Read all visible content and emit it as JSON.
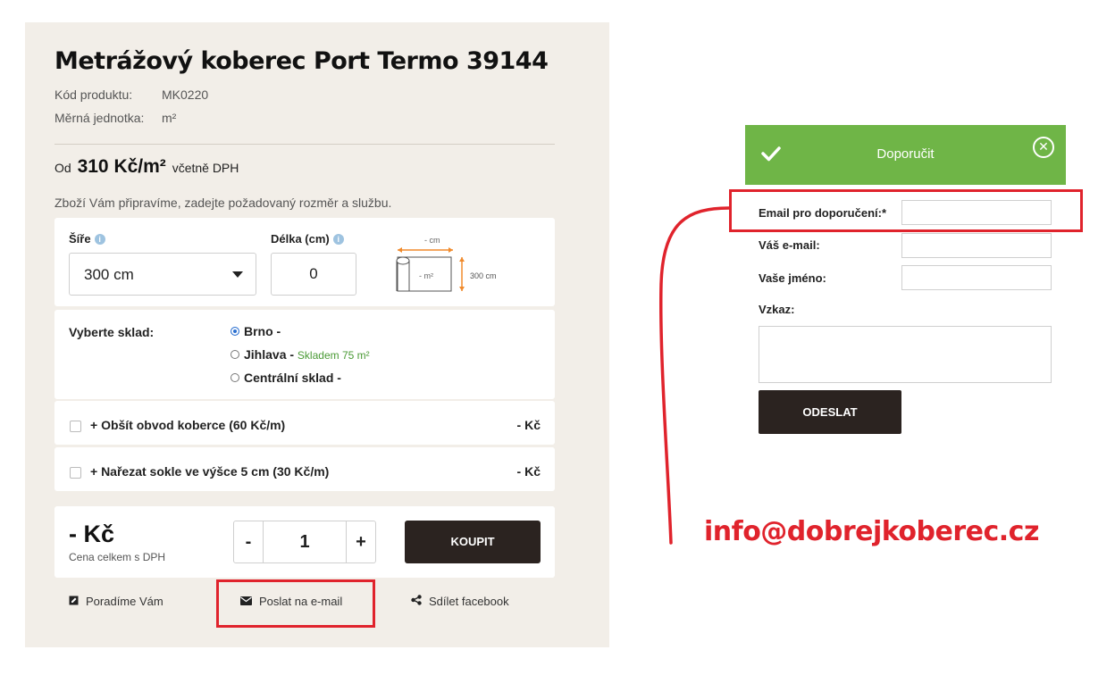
{
  "product": {
    "title": "Metrážový koberec Port Termo 39144",
    "code_label": "Kód produktu:",
    "code_value": "MK0220",
    "unit_label": "Měrná jednotka:",
    "unit_value": "m²",
    "price_prefix": "Od",
    "price_value": "310 Kč/m²",
    "price_suffix": "včetně DPH",
    "note": "Zboží Vám připravíme, zadejte požadovaný rozměr a službu."
  },
  "dimensions": {
    "width_label": "Šíře",
    "width_value": "300 cm",
    "length_label": "Délka (cm)",
    "length_value": "0",
    "diagram_top": "- cm",
    "diagram_area": "- m²",
    "diagram_side": "300 cm"
  },
  "warehouse": {
    "label": "Vyberte sklad:",
    "options": [
      {
        "name": "Brno -",
        "stock": "",
        "selected": true
      },
      {
        "name": "Jihlava -",
        "stock": "Skladem 75 m²",
        "selected": false
      },
      {
        "name": "Centrální sklad -",
        "stock": "",
        "selected": false
      }
    ]
  },
  "services": [
    {
      "label": "+ Obšít obvod koberce (60 Kč/m)",
      "price": "- Kč"
    },
    {
      "label": "+ Nařezat sokle ve výšce 5 cm (30 Kč/m)",
      "price": "- Kč"
    }
  ],
  "cart": {
    "total": "- Kč",
    "total_note": "Cena celkem s DPH",
    "minus": "-",
    "quantity": "1",
    "plus": "+",
    "buy_label": "KOUPIT"
  },
  "actions": {
    "advise": "Poradíme Vám",
    "send_email": "Poslat na e-mail",
    "share": "Sdílet facebook"
  },
  "recommend_modal": {
    "title": "Doporučit",
    "close": "✕",
    "email_label": "Email pro doporučení:*",
    "your_email_label": "Váš e-mail:",
    "your_name_label": "Vaše jméno:",
    "message_label": "Vzkaz:",
    "submit_label": "ODESLAT"
  },
  "annotation_email": "info@dobrejkoberec.cz",
  "colors": {
    "panel_bg": "#f2eee8",
    "dark_button": "#2b2320",
    "modal_green": "#6fb547",
    "highlight_red": "#e0232c",
    "stock_green": "#4a9a35"
  }
}
